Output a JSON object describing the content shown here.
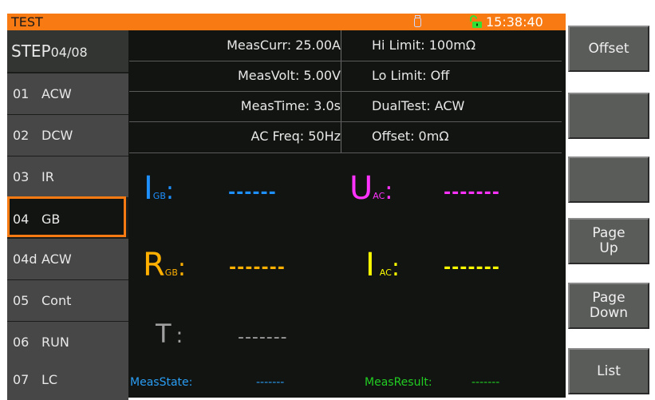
{
  "header": {
    "title": "TEST",
    "time": "15:38:40",
    "usb_icon": "usb-drive-icon",
    "lock_icon": "unlocked-lock-icon"
  },
  "steps": {
    "header_label": "STEP",
    "header_counter": "04/08",
    "items": [
      {
        "no": "01",
        "name": "ACW"
      },
      {
        "no": "02",
        "name": "DCW"
      },
      {
        "no": "03",
        "name": "IR"
      },
      {
        "no": "04",
        "name": "GB",
        "selected": true
      },
      {
        "no": "04d",
        "name": "ACW"
      },
      {
        "no": "05",
        "name": "Cont"
      },
      {
        "no": "06",
        "name": "RUN"
      },
      {
        "no": "07",
        "name": "LC"
      }
    ]
  },
  "params": {
    "rows": [
      {
        "left": "MeasCurr: 25.00A",
        "right": "Hi Limit: 100mΩ"
      },
      {
        "left": "MeasVolt: 5.00V",
        "right": "Lo Limit: Off"
      },
      {
        "left": "MeasTime: 3.0s",
        "right": "DualTest: ACW"
      },
      {
        "left": "AC Freq: 50Hz",
        "right": "Offset: 0mΩ"
      }
    ]
  },
  "measurements": {
    "i_gb": {
      "symbol": "I",
      "sub": "GB",
      "colon": ":",
      "value": "------",
      "color": "#1e90ff"
    },
    "u_ac": {
      "symbol": "U",
      "sub": "AC",
      "colon": ":",
      "value": "-------",
      "color": "#ff33ff"
    },
    "r_gb": {
      "symbol": "R",
      "sub": "GB",
      "colon": ":",
      "value": "-------",
      "color": "#ffb000"
    },
    "i_ac": {
      "symbol": "I",
      "sub": "AC",
      "colon": ":",
      "value": "-------",
      "color": "#ffff00"
    },
    "t": {
      "symbol": "T",
      "colon": ":",
      "value": "-------",
      "color": "#a0a0a0"
    }
  },
  "status": {
    "state_label": "MeasState:",
    "state_value": "-------",
    "result_label": "MeasResult:",
    "result_value": "-------",
    "state_color": "#2a9df4",
    "result_color": "#22cc22"
  },
  "softkeys": [
    "Offset",
    "",
    "",
    "Page\nUp",
    "Page\nDown",
    "List"
  ],
  "colors": {
    "accent": "#f77a12",
    "background": "#111411"
  }
}
